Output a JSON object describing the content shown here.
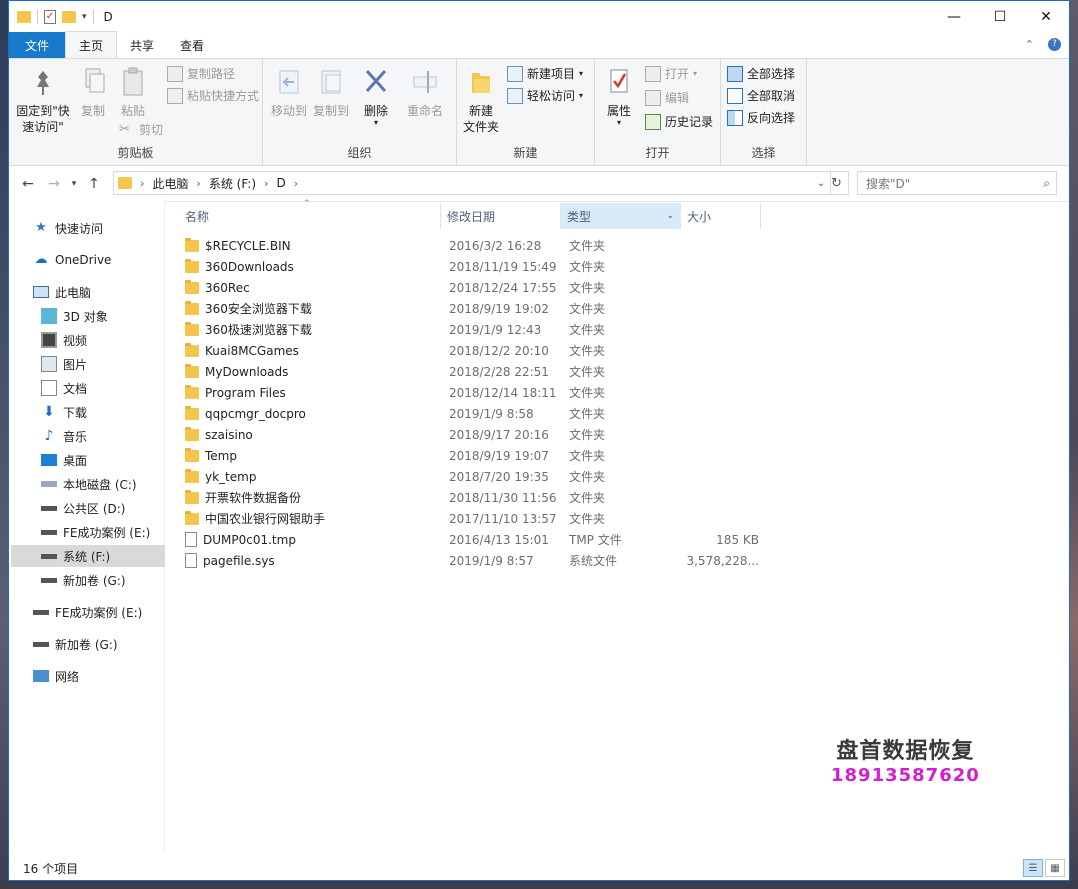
{
  "window": {
    "title": "D"
  },
  "ribbon_tabs": [
    {
      "label": "文件"
    },
    {
      "label": "主页"
    },
    {
      "label": "共享"
    },
    {
      "label": "查看"
    }
  ],
  "ribbon": {
    "clipboard": {
      "pin_label": "固定到\"快\n速访问\"",
      "copy_label": "复制",
      "paste_label": "粘贴",
      "copy_path_label": "复制路径",
      "paste_shortcut_label": "粘贴快捷方式",
      "cut_label": "剪切",
      "group_label": "剪贴板"
    },
    "organize": {
      "move_to_label": "移动到",
      "copy_to_label": "复制到",
      "delete_label": "删除",
      "rename_label": "重命名",
      "group_label": "组织"
    },
    "new": {
      "new_folder_label": "新建\n文件夹",
      "new_item_label": "新建项目",
      "easy_access_label": "轻松访问",
      "group_label": "新建"
    },
    "open": {
      "properties_label": "属性",
      "open_label": "打开",
      "edit_label": "编辑",
      "history_label": "历史记录",
      "group_label": "打开"
    },
    "select": {
      "select_all_label": "全部选择",
      "select_none_label": "全部取消",
      "invert_label": "反向选择",
      "group_label": "选择"
    }
  },
  "address": {
    "crumbs": [
      "此电脑",
      "系统 (F:)",
      "D"
    ],
    "search_placeholder": "搜索\"D\""
  },
  "nav": {
    "items": [
      {
        "label": "快速访问"
      },
      {
        "label": "OneDrive"
      },
      {
        "label": "此电脑"
      },
      {
        "label": "3D 对象"
      },
      {
        "label": "视频"
      },
      {
        "label": "图片"
      },
      {
        "label": "文档"
      },
      {
        "label": "下载"
      },
      {
        "label": "音乐"
      },
      {
        "label": "桌面"
      },
      {
        "label": "本地磁盘 (C:)"
      },
      {
        "label": "公共区 (D:)"
      },
      {
        "label": "FE成功案例 (E:)"
      },
      {
        "label": "系统 (F:)"
      },
      {
        "label": "新加卷 (G:)"
      },
      {
        "label": "FE成功案例 (E:)"
      },
      {
        "label": "新加卷 (G:)"
      },
      {
        "label": "网络"
      }
    ]
  },
  "columns": {
    "name": "名称",
    "date": "修改日期",
    "type": "类型",
    "size": "大小"
  },
  "files": [
    {
      "name": "$RECYCLE.BIN",
      "date": "2016/3/2 16:28",
      "type": "文件夹",
      "size": ""
    },
    {
      "name": "360Downloads",
      "date": "2018/11/19 15:49",
      "type": "文件夹",
      "size": ""
    },
    {
      "name": "360Rec",
      "date": "2018/12/24 17:55",
      "type": "文件夹",
      "size": ""
    },
    {
      "name": "360安全浏览器下载",
      "date": "2018/9/19 19:02",
      "type": "文件夹",
      "size": ""
    },
    {
      "name": "360极速浏览器下载",
      "date": "2019/1/9 12:43",
      "type": "文件夹",
      "size": ""
    },
    {
      "name": "Kuai8MCGames",
      "date": "2018/12/2 20:10",
      "type": "文件夹",
      "size": ""
    },
    {
      "name": "MyDownloads",
      "date": "2018/2/28 22:51",
      "type": "文件夹",
      "size": ""
    },
    {
      "name": "Program Files",
      "date": "2018/12/14 18:11",
      "type": "文件夹",
      "size": ""
    },
    {
      "name": "qqpcmgr_docpro",
      "date": "2019/1/9 8:58",
      "type": "文件夹",
      "size": ""
    },
    {
      "name": "szaisino",
      "date": "2018/9/17 20:16",
      "type": "文件夹",
      "size": ""
    },
    {
      "name": "Temp",
      "date": "2018/9/19 19:07",
      "type": "文件夹",
      "size": ""
    },
    {
      "name": "yk_temp",
      "date": "2018/7/20 19:35",
      "type": "文件夹",
      "size": ""
    },
    {
      "name": "开票软件数据备份",
      "date": "2018/11/30 11:56",
      "type": "文件夹",
      "size": ""
    },
    {
      "name": "中国农业银行网银助手",
      "date": "2017/11/10 13:57",
      "type": "文件夹",
      "size": ""
    },
    {
      "name": "DUMP0c01.tmp",
      "date": "2016/4/13 15:01",
      "type": "TMP 文件",
      "size": "185 KB"
    },
    {
      "name": "pagefile.sys",
      "date": "2019/1/9 8:57",
      "type": "系统文件",
      "size": "3,578,228..."
    }
  ],
  "status": {
    "count": "16 个项目"
  },
  "watermark": {
    "line1": "盘首数据恢复",
    "line2": "18913587620"
  },
  "colors": {
    "accent": "#1979ca",
    "folder": "#f4c64e",
    "selected_col": "#d9ebf9",
    "watermark_phone": "#d020d0"
  }
}
